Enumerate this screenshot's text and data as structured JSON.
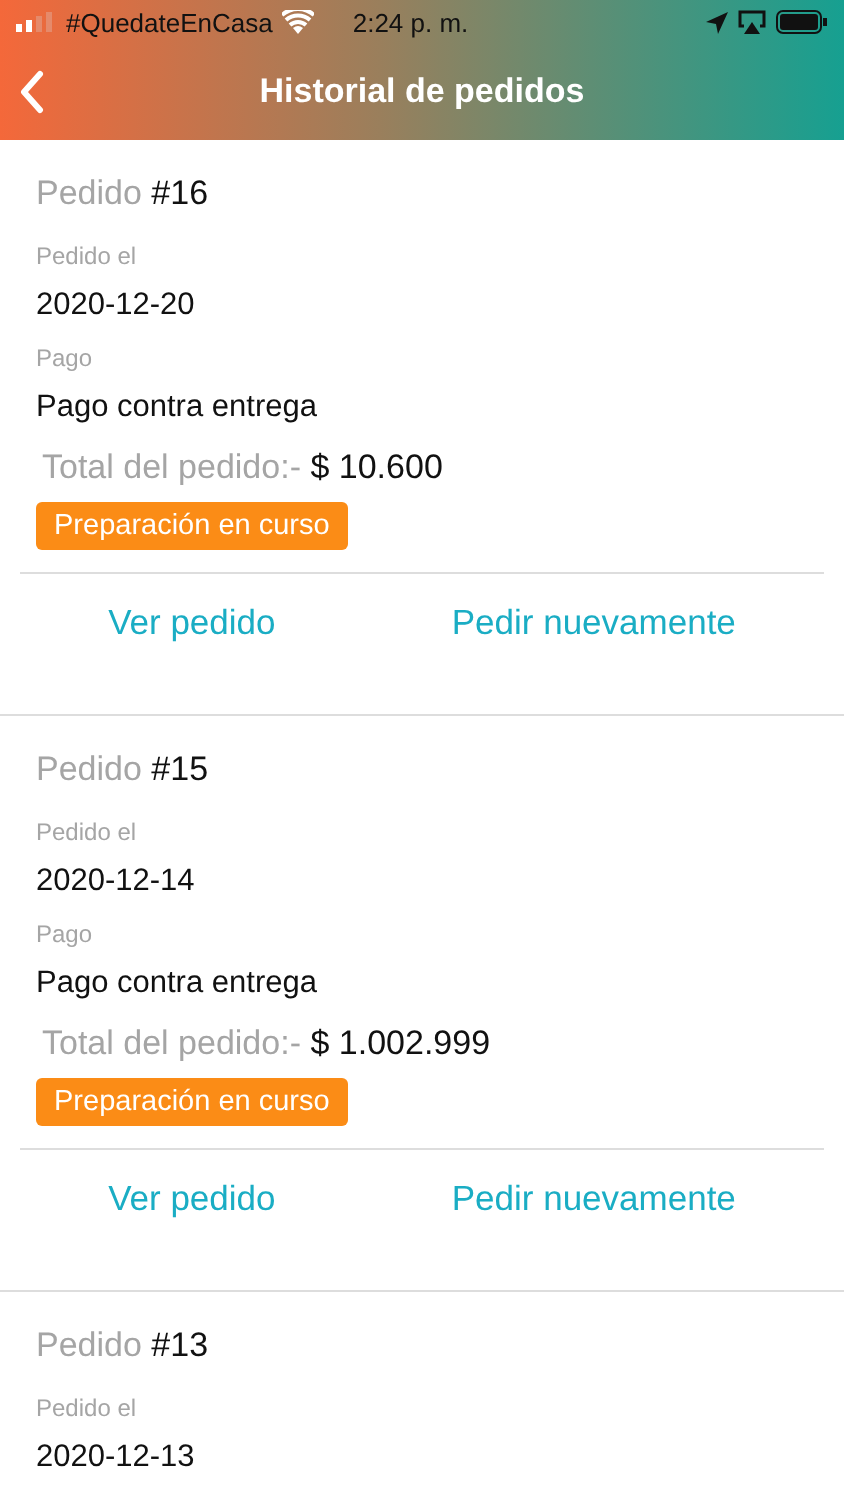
{
  "status_bar": {
    "carrier": "#QuedateEnCasa",
    "time": "2:24 p. m."
  },
  "nav": {
    "title": "Historial de pedidos"
  },
  "orders": [
    {
      "number_label": "Pedido",
      "number": "#16",
      "date_label": "Pedido el",
      "date": "2020-12-20",
      "payment_label": "Pago",
      "payment": "Pago contra entrega",
      "total_label": "Total del pedido:-",
      "total": "$ 10.600",
      "status": "Preparación en curso",
      "actions": [
        "Ver pedido",
        "Pedir nuevamente"
      ]
    },
    {
      "number_label": "Pedido",
      "number": "#15",
      "date_label": "Pedido el",
      "date": "2020-12-14",
      "payment_label": "Pago",
      "payment": "Pago contra entrega",
      "total_label": "Total del pedido:-",
      "total": "$ 1.002.999",
      "status": "Preparación en curso",
      "actions": [
        "Ver pedido",
        "Pedir nuevamente"
      ]
    },
    {
      "number_label": "Pedido",
      "number": "#13",
      "date_label": "Pedido el",
      "date": "2020-12-13"
    }
  ]
}
